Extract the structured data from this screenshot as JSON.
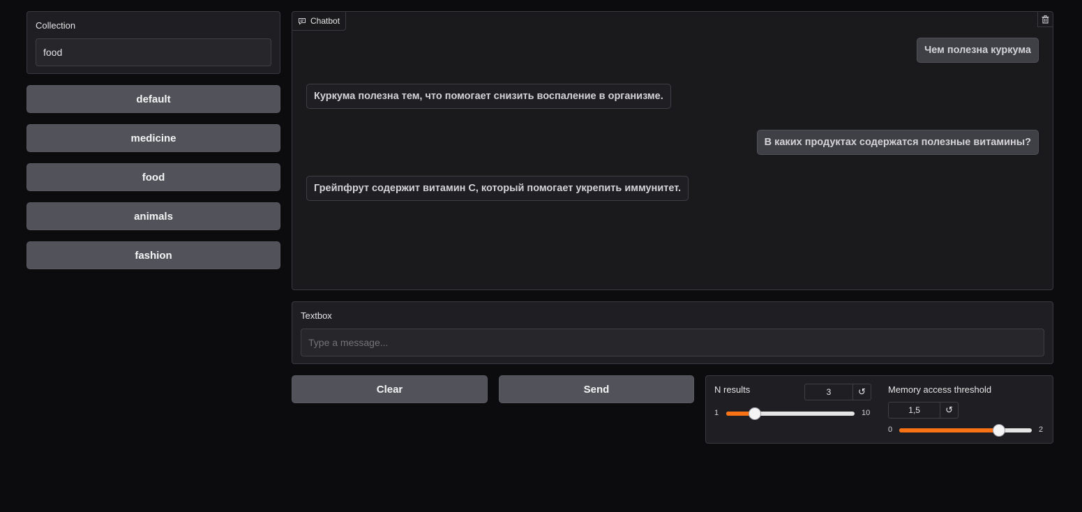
{
  "collection": {
    "label": "Collection",
    "value": "food"
  },
  "collection_buttons": [
    "default",
    "medicine",
    "food",
    "animals",
    "fashion"
  ],
  "chatbot": {
    "tab_label": "Chatbot",
    "icon": "chat-icon",
    "clear_icon": "trash-icon",
    "messages": [
      {
        "role": "user",
        "text": "Чем полезна куркума"
      },
      {
        "role": "bot",
        "text": "Куркума полезна тем, что помогает снизить воспаление в организме."
      },
      {
        "role": "user",
        "text": "В каких продуктах содержатся полезные витамины?"
      },
      {
        "role": "bot",
        "text": "Грейпфрут содержит витамин С, который помогает укрепить иммунитет."
      }
    ]
  },
  "textbox": {
    "label": "Textbox",
    "placeholder": "Type a message..."
  },
  "actions": {
    "clear_label": "Clear",
    "send_label": "Send"
  },
  "n_results": {
    "label": "N results",
    "value": "3",
    "min": "1",
    "max": "10",
    "fraction": 0.2222,
    "reset_icon": "↺"
  },
  "memory_threshold": {
    "label": "Memory access threshold",
    "value": "1,5",
    "min": "0",
    "max": "2",
    "fraction": 0.75,
    "reset_icon": "↺"
  },
  "colors": {
    "accent": "#f97316",
    "background": "#0c0c0f",
    "panel": "#1f1f23",
    "button": "#52525b"
  }
}
